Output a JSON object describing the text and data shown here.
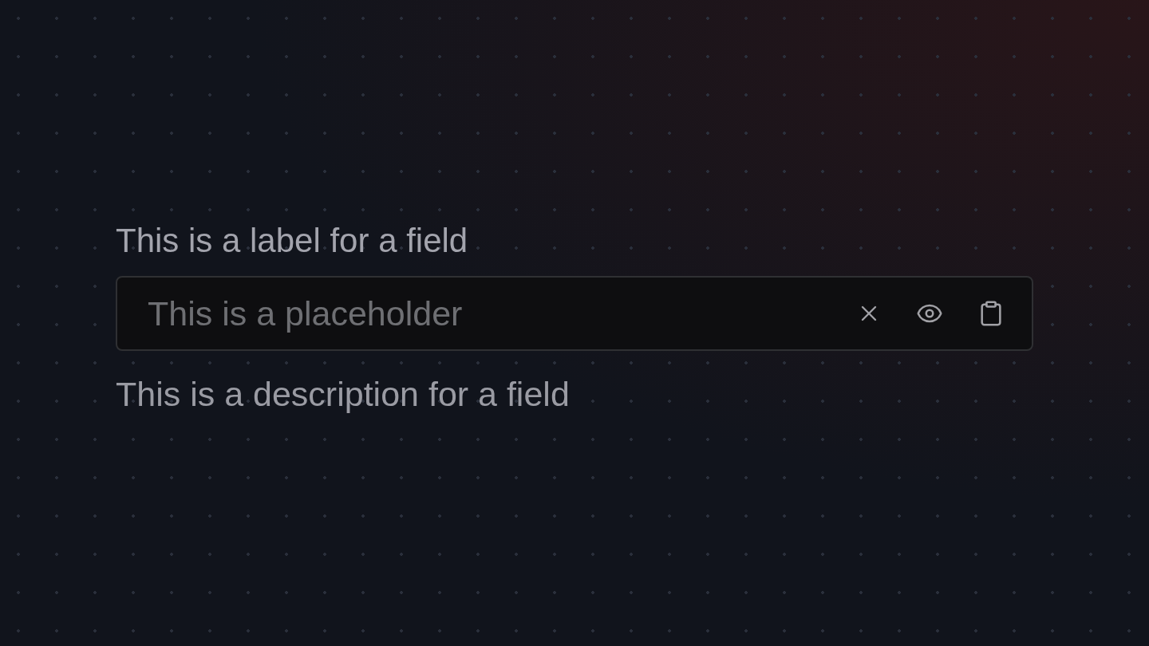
{
  "field": {
    "label": "This is a label for a field",
    "placeholder": "This is a placeholder",
    "description": "This is a description for a field"
  }
}
